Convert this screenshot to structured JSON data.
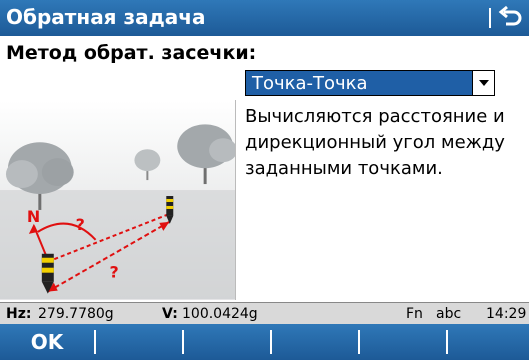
{
  "window": {
    "title": "Обратная задача"
  },
  "method": {
    "label": "Метод обрат. засечки:",
    "selected": "Точка-Точка"
  },
  "illustration": {
    "north_label": "N",
    "angle_label": "?",
    "distance_label": "?"
  },
  "description": "Вычисляются расстояние и дирекционный угол между заданными точками.",
  "status": {
    "hz_label": "Hz:",
    "hz_value": "279.7780g",
    "v_label": "V:",
    "v_value": "100.0424g",
    "fn": "Fn",
    "input_mode": "abc",
    "time": "14:29"
  },
  "softkeys": {
    "f1": "OK"
  },
  "colors": {
    "bar": "#1d5a97",
    "accent_red": "#e01010"
  }
}
